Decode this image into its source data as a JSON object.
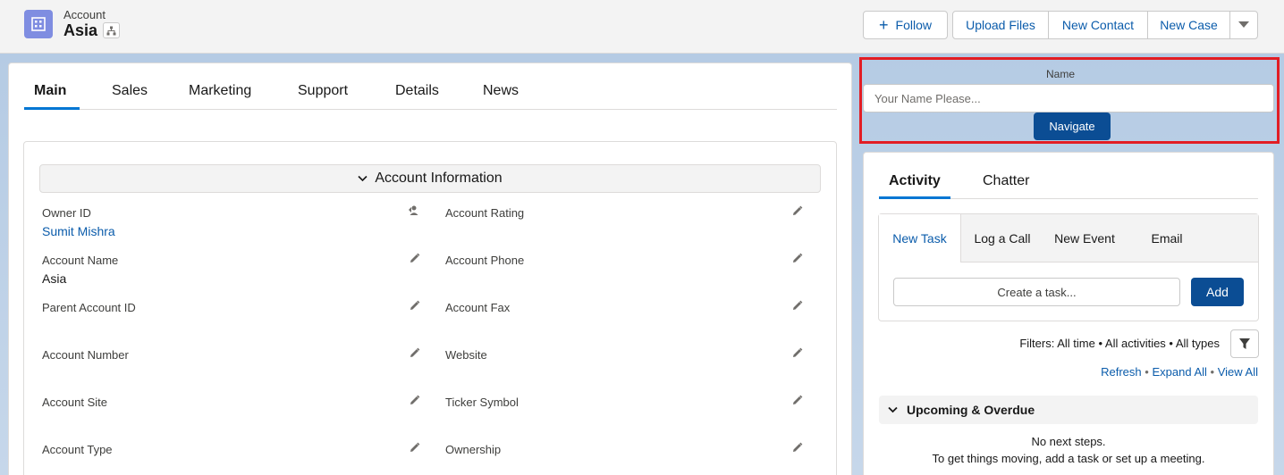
{
  "header": {
    "object_label": "Account",
    "record_name": "Asia",
    "buttons": {
      "follow": "Follow",
      "upload_files": "Upload Files",
      "new_contact": "New Contact",
      "new_case": "New Case"
    },
    "icons": {
      "object": "account-icon",
      "hierarchy": "hierarchy-icon",
      "plus": "plus-icon",
      "more": "chevron-down-icon"
    }
  },
  "record_tabs": [
    "Main",
    "Sales",
    "Marketing",
    "Support",
    "Details",
    "News"
  ],
  "section": {
    "title": "Account Information",
    "fields": [
      {
        "label": "Owner ID",
        "value": "Sumit Mishra",
        "link": true
      },
      {
        "label": "Account Rating",
        "value": ""
      },
      {
        "label": "Account Name",
        "value": "Asia"
      },
      {
        "label": "Account Phone",
        "value": ""
      },
      {
        "label": "Parent Account ID",
        "value": ""
      },
      {
        "label": "Account Fax",
        "value": ""
      },
      {
        "label": "Account Number",
        "value": ""
      },
      {
        "label": "Website",
        "value": ""
      },
      {
        "label": "Account Site",
        "value": ""
      },
      {
        "label": "Ticker Symbol",
        "value": ""
      },
      {
        "label": "Account Type",
        "value": ""
      },
      {
        "label": "Ownership",
        "value": ""
      }
    ]
  },
  "navigate_component": {
    "label": "Name",
    "placeholder": "Your Name Please...",
    "button": "Navigate",
    "highlight_color": "#e21d24"
  },
  "activity": {
    "tabs": [
      "Activity",
      "Chatter"
    ],
    "publisher_tabs": [
      "New Task",
      "Log a Call",
      "New Event",
      "Email"
    ],
    "task_placeholder": "Create a task...",
    "add_button": "Add",
    "filters_text": "Filters: All time • All activities • All types",
    "links": {
      "refresh": "Refresh",
      "expand_all": "Expand All",
      "view_all": "View All",
      "separator": "•"
    },
    "upcoming_title": "Upcoming & Overdue",
    "no_steps": "No next steps.",
    "no_steps_hint": "To get things moving, add a task or set up a meeting."
  },
  "colors": {
    "brand_blue": "#0176d3",
    "link_blue": "#0b5cab",
    "button_dark_blue": "#0b4d94",
    "object_icon": "#7f8de1"
  }
}
